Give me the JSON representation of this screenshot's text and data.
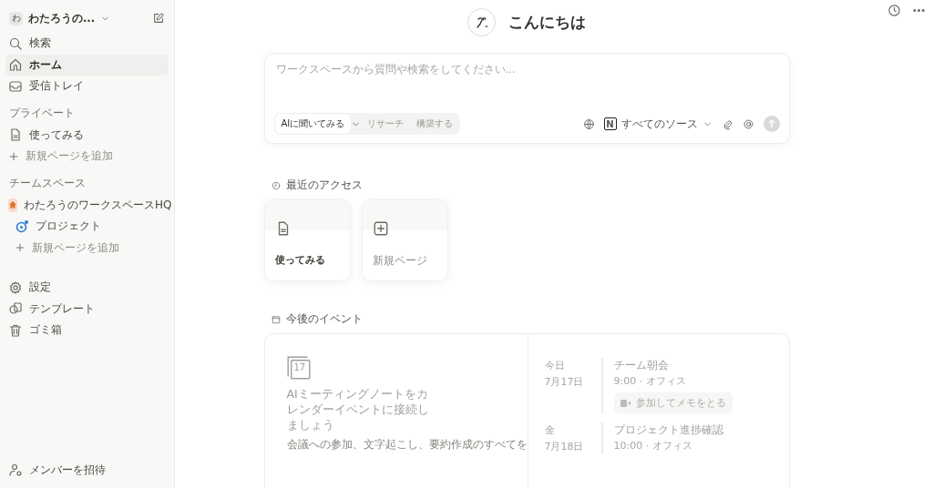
{
  "sidebar": {
    "workspace": {
      "initial": "わ",
      "name": "わたろうの..."
    },
    "nav": [
      {
        "label": "検索",
        "kind": "search",
        "selected": false
      },
      {
        "label": "ホーム",
        "kind": "home",
        "selected": true
      },
      {
        "label": "受信トレイ",
        "kind": "inbox",
        "selected": false
      }
    ],
    "sections": [
      {
        "title": "プライベート",
        "items": [
          {
            "label": "使ってみる",
            "kind": "page"
          },
          {
            "label": "新規ページを追加",
            "kind": "add"
          }
        ]
      },
      {
        "title": "チームスペース",
        "items": [
          {
            "label": "わたろうのワークスペースHQ",
            "kind": "team",
            "children": [
              {
                "label": "プロジェクト",
                "kind": "project"
              },
              {
                "label": "新規ページを追加",
                "kind": "add"
              }
            ]
          }
        ]
      }
    ],
    "tools": [
      {
        "label": "設定",
        "kind": "settings"
      },
      {
        "label": "テンプレート",
        "kind": "templates"
      },
      {
        "label": "ゴミ箱",
        "kind": "trash"
      }
    ],
    "invite": "メンバーを招待"
  },
  "greeting": "こんにちは",
  "ask": {
    "placeholder": "ワークスペースから質問や検索をしてください...",
    "modes": [
      {
        "label": "AIに聞いてみる",
        "selected": true
      },
      {
        "label": "リサーチ",
        "selected": false
      },
      {
        "label": "構築する",
        "selected": false
      }
    ],
    "source_logo": "N",
    "source": "すべてのソース"
  },
  "recent": {
    "title": "最近のアクセス",
    "cards": [
      {
        "label": "使ってみる",
        "kind": "page"
      },
      {
        "label": "新規ページ",
        "kind": "new"
      }
    ]
  },
  "events": {
    "title": "今後のイベント",
    "promo": {
      "icon_day": "17",
      "heading": "AIミーティングノートをカレンダーイベントに接続しましょう",
      "body": "会議への参加、文字起こし、要約作成のすべてを"
    },
    "days": [
      {
        "day": "今日",
        "date": "7月17日",
        "items": [
          {
            "title": "チーム朝会",
            "meta": "9:00 · オフィス",
            "join": "参加してメモをとる"
          }
        ]
      },
      {
        "day": "金",
        "date": "7月18日",
        "items": [
          {
            "title": "プロジェクト進捗確認",
            "meta": "10:00 · オフィス"
          }
        ]
      }
    ]
  }
}
